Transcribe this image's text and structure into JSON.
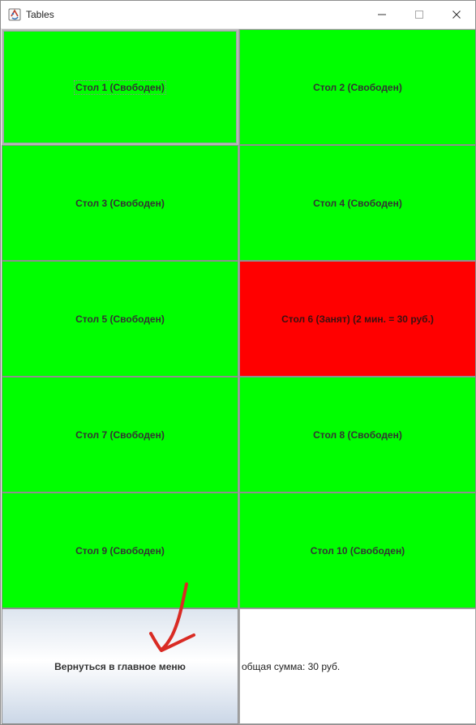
{
  "window": {
    "title": "Tables",
    "icon": "java-app-icon"
  },
  "tables": [
    {
      "label": "Стол 1 (Свободен)",
      "status": "free"
    },
    {
      "label": "Стол 2 (Свободен)",
      "status": "free"
    },
    {
      "label": "Стол 3 (Свободен)",
      "status": "free"
    },
    {
      "label": "Стол 4 (Свободен)",
      "status": "free"
    },
    {
      "label": "Стол 5 (Свободен)",
      "status": "free"
    },
    {
      "label": "Стол 6 (Занят) (2 мин. = 30 руб.)",
      "status": "occupied"
    },
    {
      "label": "Стол 7 (Свободен)",
      "status": "free"
    },
    {
      "label": "Стол 8 (Свободен)",
      "status": "free"
    },
    {
      "label": "Стол 9 (Свободен)",
      "status": "free"
    },
    {
      "label": "Стол 10 (Свободен)",
      "status": "free"
    }
  ],
  "footer": {
    "back_label": "Вернуться в главное меню",
    "total_label": "общая сумма: 30 руб."
  },
  "colors": {
    "free": "#00ff00",
    "occupied": "#ff0000",
    "annotation_arrow": "#d92b24"
  }
}
